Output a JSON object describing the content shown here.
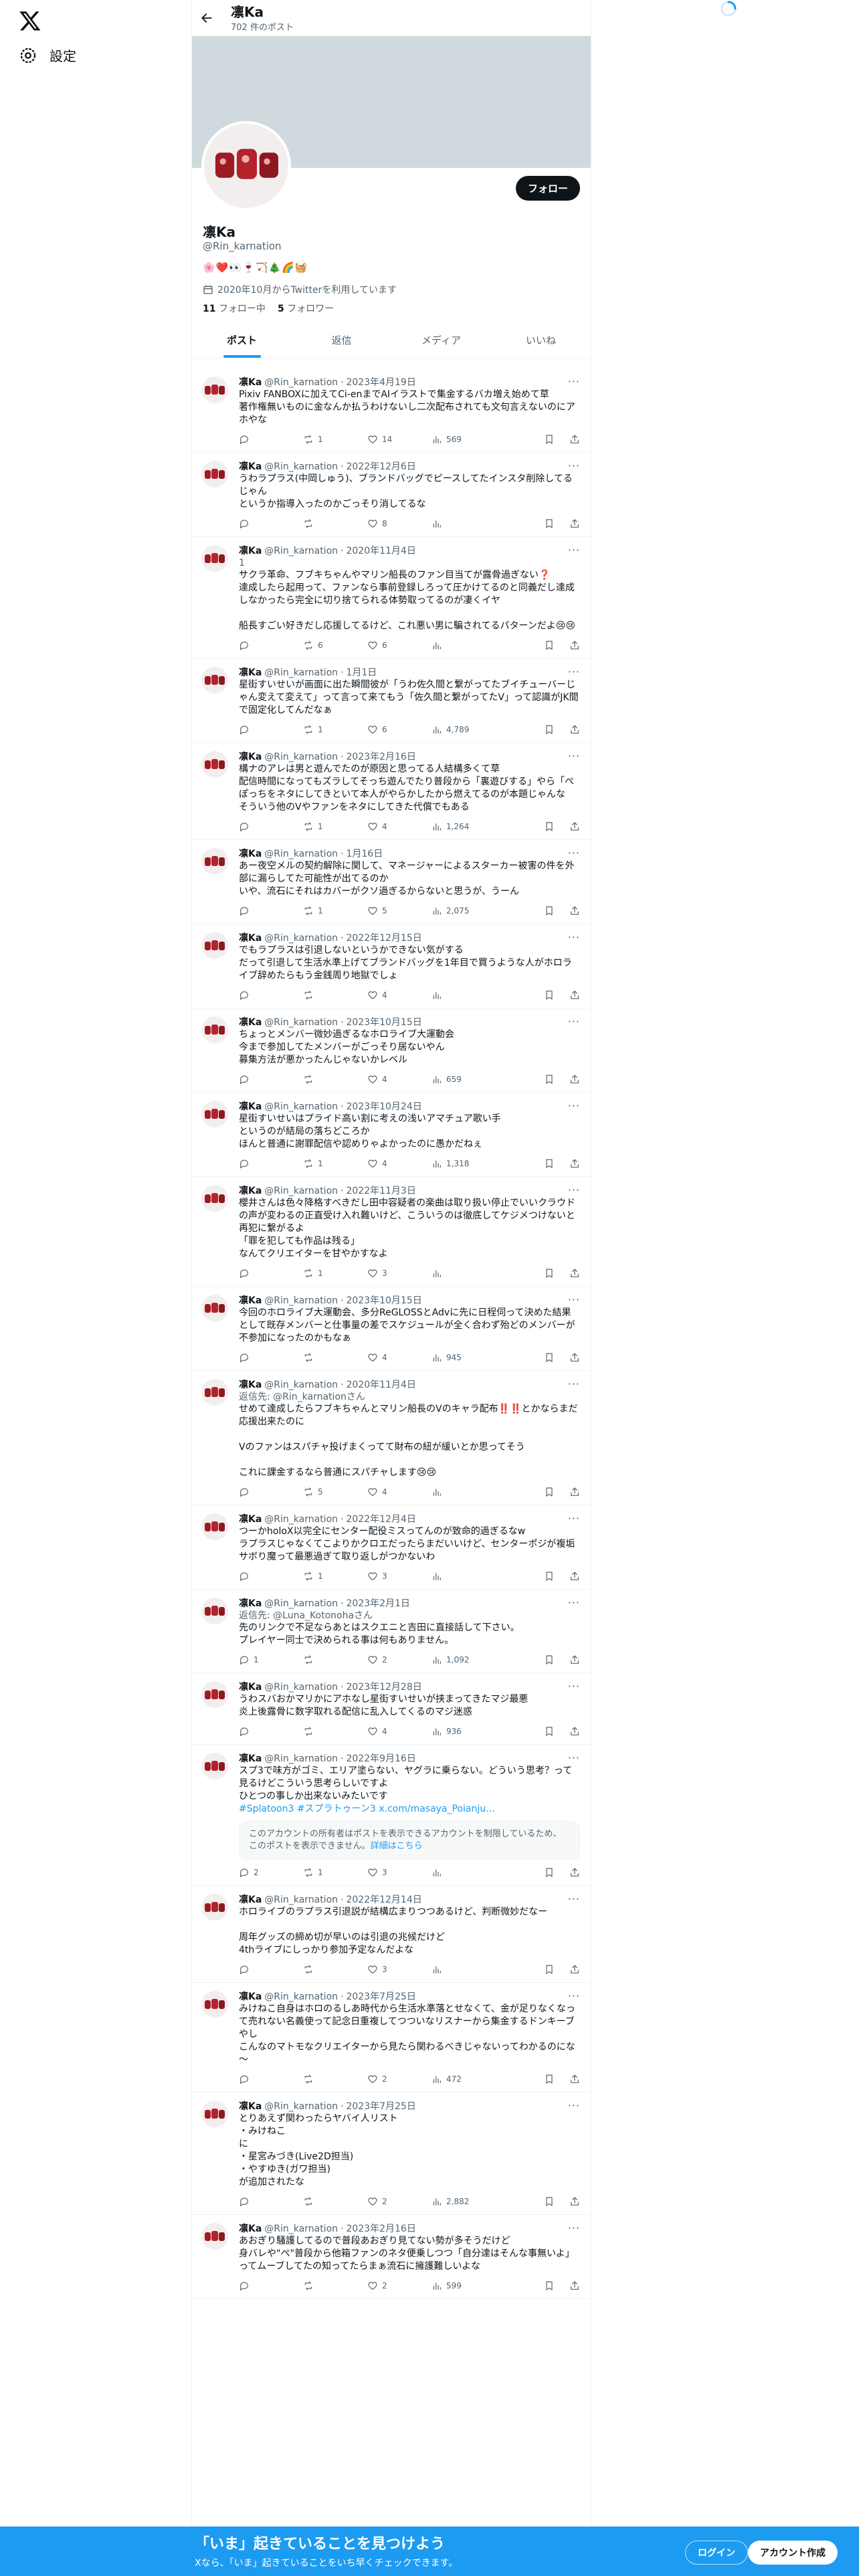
{
  "nav": {
    "settings_label": "設定"
  },
  "header": {
    "name": "凛Ka",
    "post_count": "702 件のポスト"
  },
  "profile": {
    "follow_label": "フォロー",
    "name": "凛Ka",
    "handle": "@Rin_karnation",
    "bio": "🌸❤️👀🍷🏹🎄🌈🧺",
    "joined": "2020年10月からTwitterを利用しています",
    "following_count": "11",
    "following_label": "フォロー中",
    "followers_count": "5",
    "followers_label": "フォロワー"
  },
  "tabs": [
    "ポスト",
    "返信",
    "メディア",
    "いいね"
  ],
  "tweets": [
    {
      "name": "凛Ka",
      "handle": "@Rin_karnation",
      "date": "2023年4月19日",
      "text": "Pixiv FANBOXに加えてCi-enまでAIイラストで集金するバカ増え始めて草\n著作権無いものに金なんか払うわけないし二次配布されても文句言えないのにアホやな",
      "reply": "",
      "retweets": "1",
      "likes": "14",
      "views": "569"
    },
    {
      "name": "凛Ka",
      "handle": "@Rin_karnation",
      "date": "2022年12月6日",
      "text": "うわラプラス(中岡しゅう)、ブランドバッグでピースしてたインスタ削除してるじゃん\nというか指導入ったのかごっそり消してるな",
      "reply": "",
      "retweets": "",
      "likes": "8",
      "views": ""
    },
    {
      "name": "凛Ka",
      "handle": "@Rin_karnation",
      "date": "2020年11月4日",
      "text": "サクラ革命、フブキちゃんやマリン船長のファン目当てが露骨過ぎない❓\n達成したら起用って、ファンなら事前登録しろって圧かけてるのと同義だし達成しなかったら完全に切り捨てられる体勢取ってるのが凄くイヤ\n\n船長すごい好きだし応援してるけど、これ悪い男に騙されてるパターンだよ😢😢",
      "reply": "1",
      "retweets": "6",
      "likes": "6",
      "views": ""
    },
    {
      "name": "凛Ka",
      "handle": "@Rin_karnation",
      "date": "1月1日",
      "text": "星街すいせいが画面に出た瞬間彼が「うわ佐久間と繋がってたブイチューバーじゃん変えて変えて」って言って来てもう「佐久間と繋がってたV」って認識がJK間で固定化してんだなぁ",
      "reply": "",
      "retweets": "1",
      "likes": "6",
      "views": "4,789"
    },
    {
      "name": "凛Ka",
      "handle": "@Rin_karnation",
      "date": "2023年2月16日",
      "text": "構ナのアレは男と遊んでたのが原因と思ってる人結構多くて草\n配信時間になってもズラしてそっち遊んでたり普段から「裏遊びする」やら「ぺぽっちをネタにしてきといて本人がやらかしたから燃えてるのが本題じゃんな\nそういう他のVやファンをネタにしてきた代償でもある",
      "reply": "",
      "retweets": "1",
      "likes": "4",
      "views": "1,264"
    },
    {
      "name": "凛Ka",
      "handle": "@Rin_karnation",
      "date": "1月16日",
      "text": "あー夜空メルの契約解除に関して、マネージャーによるスターカー被害の件を外部に漏らしてた可能性が出てるのか\nいや、流石にそれはカバーがクソ過ぎるからないと思うが、うーん",
      "reply": "",
      "retweets": "1",
      "likes": "5",
      "views": "2,075"
    },
    {
      "name": "凛Ka",
      "handle": "@Rin_karnation",
      "date": "2022年12月15日",
      "text": "でもラプラスは引退しないというかできない気がする\nだって引退して生活水準上げてブランドバッグを1年目で買うような人がホロライブ辞めたらもう金銭周り地獄でしょ",
      "reply": "",
      "retweets": "",
      "likes": "4",
      "views": ""
    },
    {
      "name": "凛Ka",
      "handle": "@Rin_karnation",
      "date": "2023年10月15日",
      "text": "ちょっとメンバー微妙過ぎるなホロライブ大運動会\n今まで参加してたメンバーがごっそり居ないやん\n募集方法が悪かったんじゃないかレベル",
      "reply": "",
      "retweets": "",
      "likes": "4",
      "views": "659"
    },
    {
      "name": "凛Ka",
      "handle": "@Rin_karnation",
      "date": "2023年10月24日",
      "text": "星街すいせいはプライド高い割に考えの浅いアマチュア歌い手\nというのが結局の落ちどころか\nほんと普通に謝罪配信や認めりゃよかったのに愚かだねぇ",
      "reply": "",
      "retweets": "1",
      "likes": "4",
      "views": "1,318"
    },
    {
      "name": "凛Ka",
      "handle": "@Rin_karnation",
      "date": "2022年11月3日",
      "text": "櫻井さんは色々降格すべきだし田中容疑者の楽曲は取り扱い停止でいいクラウドの声が変わるの正直受け入れ難いけど、こういうのは徹底してケジメつけないと再犯に繋がるよ\n「罪を犯しても作品は残る」\nなんてクリエイターを甘やかすなよ",
      "reply": "",
      "retweets": "1",
      "likes": "3",
      "views": ""
    },
    {
      "name": "凛Ka",
      "handle": "@Rin_karnation",
      "date": "2023年10月15日",
      "text": "今回のホロライブ大運動会、多分ReGLOSSとAdvに先に日程伺って決めた結果として既存メンバーと仕事量の差でスケジュールが全く合わず殆どのメンバーが不参加になったのかもなぁ",
      "reply": "",
      "retweets": "",
      "likes": "4",
      "views": "945"
    },
    {
      "name": "凛Ka",
      "handle": "@Rin_karnation",
      "date": "2020年11月4日",
      "text": "せめて達成したらフブキちゃんとマリン船長のVのキャラ配布‼️‼️とかならまだ応援出来たのに\n\nVのファンはスパチャ投げまくってて財布の紐が緩いとか思ってそう\n\nこれに課金するなら普通にスパチャします😢😢",
      "reply": "返信先: @Rin_karnationさん",
      "retweets": "5",
      "likes": "4",
      "views": ""
    },
    {
      "name": "凛Ka",
      "handle": "@Rin_karnation",
      "date": "2022年12月4日",
      "text": "つーかholoX以完全にセンター配役ミスってんのが致命的過ぎるなw\nラプラスじゃなくてこよりかクロエだったらまだいいけど、センターポジが複垢サボり魔って最悪過ぎて取り返しがつかないわ",
      "reply": "",
      "retweets": "1",
      "likes": "3",
      "views": ""
    },
    {
      "name": "凛Ka",
      "handle": "@Rin_karnation",
      "date": "2023年2月1日",
      "text": "先のリンクで不足ならあとはスクエニと吉田に直接話して下さい。\nプレイヤー同士で決められる事は何もありません。",
      "reply": "返信先: @Luna_Kotonohaさん",
      "retweets": "",
      "likes": "2",
      "views": "1,092",
      "reply_count": "1"
    },
    {
      "name": "凛Ka",
      "handle": "@Rin_karnation",
      "date": "2023年12月28日",
      "text": "うわスバおかマリかにアホなし星街すいせいが挟まってきたマジ最悪\n炎上後露骨に数字取れる配信に乱入してくるのマジ迷惑",
      "reply": "",
      "retweets": "",
      "likes": "4",
      "views": "936"
    },
    {
      "name": "凛Ka",
      "handle": "@Rin_karnation",
      "date": "2022年9月16日",
      "text": "スプ3で味方がゴミ、エリア塗らない、ヤグラに乗らない。どういう思考？って見るけどこういう思考らしいですよ\nひとつの事しか出来ないみたいです",
      "reply": "",
      "retweets": "1",
      "likes": "3",
      "views": "",
      "reply_count": "2",
      "link": "#Splatoon3 #スプラトゥーン3 x.com/masaya_Poianju…",
      "notice": "このアカウントの所有者はポストを表示できるアカウントを制限しているため、このポストを表示できません。",
      "notice_more": "詳細はこちら"
    },
    {
      "name": "凛Ka",
      "handle": "@Rin_karnation",
      "date": "2022年12月14日",
      "text": "ホロライブのラプラス引退説が結構広まりつつあるけど、判断微妙だなー\n\n周年グッズの締め切が早いのは引退の兆候だけど\n4thライブにしっかり参加予定なんだよな",
      "reply": "",
      "retweets": "",
      "likes": "3",
      "views": ""
    },
    {
      "name": "凛Ka",
      "handle": "@Rin_karnation",
      "date": "2023年7月25日",
      "text": "みけねこ自身はホロのるしあ時代から生活水準落とせなくて、金が足りなくなって売れない名義使って記念日重複してつついなリスナーから集金するドンキーブやし\nこんなのマトモなクリエイターから見たら関わるべきじゃないってわかるのにな～",
      "reply": "",
      "retweets": "",
      "likes": "2",
      "views": "472"
    },
    {
      "name": "凛Ka",
      "handle": "@Rin_karnation",
      "date": "2023年7月25日",
      "text": "とりあえず関わったらヤバイ人リスト\n・みけねこ\nに\n・星宮みづき(Live2D担当)\n・やすゆき(ガワ担当)\nが追加されたな",
      "reply": "",
      "retweets": "",
      "likes": "2",
      "views": "2,882"
    },
    {
      "name": "凛Ka",
      "handle": "@Rin_karnation",
      "date": "2023年2月16日",
      "text": "あおぎり騒護してるので普段あおぎり見てない勢が多そうだけど\n身バレや\"ぺ\"普段から他箱ファンのネタ便乗しつつ「自分達はそんな事無いよ」ってムーブしてたの知ってたらまぁ流石に擁護難しいよな",
      "reply": "",
      "retweets": "",
      "likes": "2",
      "views": "599"
    }
  ],
  "bottom": {
    "title": "「いま」起きていることを見つけよう",
    "subtitle": "Xなら、「いま」起きていることをいち早くチェックできます。",
    "login_label": "ログイン",
    "signup_label": "アカウント作成"
  }
}
